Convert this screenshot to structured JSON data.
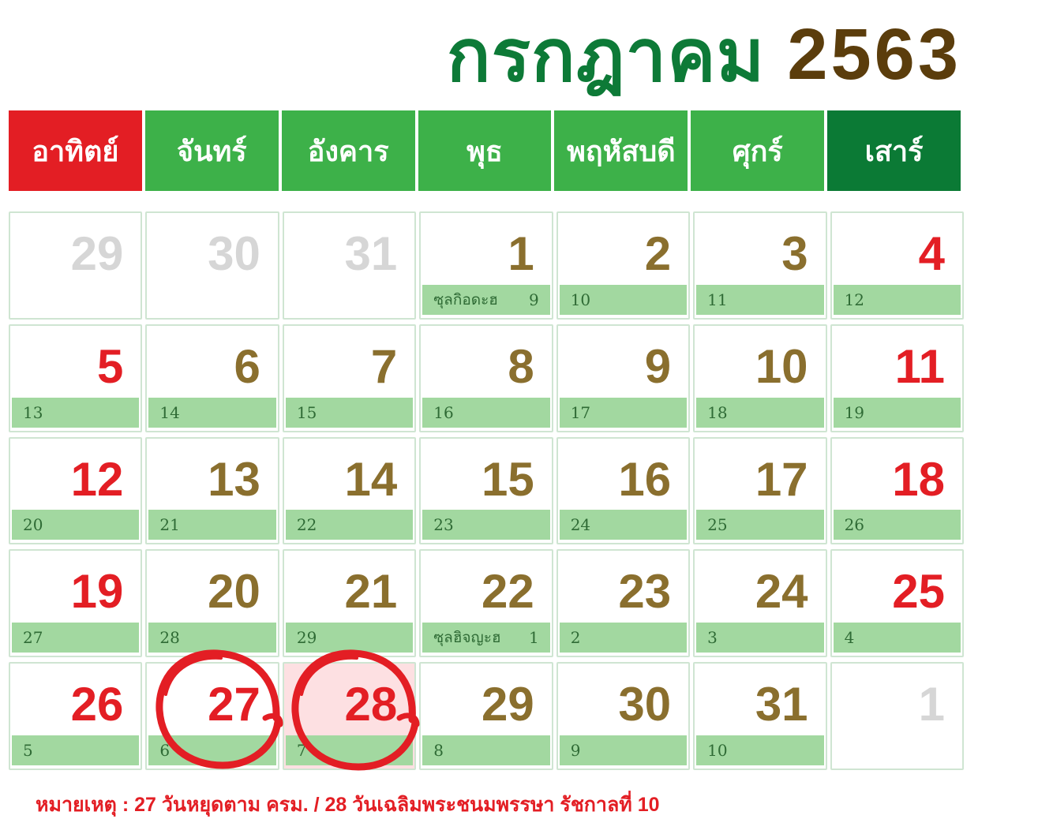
{
  "title": {
    "month": "กรกฎาคม",
    "year": "2563"
  },
  "weekdays": [
    "อาทิตย์",
    "จันทร์",
    "อังคาร",
    "พุธ",
    "พฤหัสบดี",
    "ศุกร์",
    "เสาร์"
  ],
  "colors": {
    "sunday": "#e31e24",
    "weekday": "#3db149",
    "saturday": "#0b7a35",
    "day_text": "#8a6f2e",
    "lunar_strip": "#a2d8a0"
  },
  "weeks": [
    [
      {
        "day": "29",
        "tone": "grey",
        "lunar": ""
      },
      {
        "day": "30",
        "tone": "grey",
        "lunar": ""
      },
      {
        "day": "31",
        "tone": "grey",
        "lunar": ""
      },
      {
        "day": "1",
        "tone": "normal",
        "lunar": "9",
        "lunar_name": "ซุลกิอดะฮ"
      },
      {
        "day": "2",
        "tone": "normal",
        "lunar": "10"
      },
      {
        "day": "3",
        "tone": "normal",
        "lunar": "11"
      },
      {
        "day": "4",
        "tone": "red",
        "lunar": "12"
      }
    ],
    [
      {
        "day": "5",
        "tone": "red",
        "lunar": "13"
      },
      {
        "day": "6",
        "tone": "normal",
        "lunar": "14"
      },
      {
        "day": "7",
        "tone": "normal",
        "lunar": "15"
      },
      {
        "day": "8",
        "tone": "normal",
        "lunar": "16"
      },
      {
        "day": "9",
        "tone": "normal",
        "lunar": "17"
      },
      {
        "day": "10",
        "tone": "normal",
        "lunar": "18"
      },
      {
        "day": "11",
        "tone": "red",
        "lunar": "19"
      }
    ],
    [
      {
        "day": "12",
        "tone": "red",
        "lunar": "20"
      },
      {
        "day": "13",
        "tone": "normal",
        "lunar": "21"
      },
      {
        "day": "14",
        "tone": "normal",
        "lunar": "22"
      },
      {
        "day": "15",
        "tone": "normal",
        "lunar": "23"
      },
      {
        "day": "16",
        "tone": "normal",
        "lunar": "24"
      },
      {
        "day": "17",
        "tone": "normal",
        "lunar": "25"
      },
      {
        "day": "18",
        "tone": "red",
        "lunar": "26"
      }
    ],
    [
      {
        "day": "19",
        "tone": "red",
        "lunar": "27"
      },
      {
        "day": "20",
        "tone": "normal",
        "lunar": "28"
      },
      {
        "day": "21",
        "tone": "normal",
        "lunar": "29"
      },
      {
        "day": "22",
        "tone": "normal",
        "lunar": "1",
        "lunar_name": "ซุลฮิจญะฮ"
      },
      {
        "day": "23",
        "tone": "normal",
        "lunar": "2"
      },
      {
        "day": "24",
        "tone": "normal",
        "lunar": "3"
      },
      {
        "day": "25",
        "tone": "red",
        "lunar": "4"
      }
    ],
    [
      {
        "day": "26",
        "tone": "red",
        "lunar": "5"
      },
      {
        "day": "27",
        "tone": "red",
        "lunar": "6",
        "circled": true
      },
      {
        "day": "28",
        "tone": "red",
        "lunar": "7",
        "circled": true,
        "highlight": true
      },
      {
        "day": "29",
        "tone": "normal",
        "lunar": "8"
      },
      {
        "day": "30",
        "tone": "normal",
        "lunar": "9"
      },
      {
        "day": "31",
        "tone": "normal",
        "lunar": "10"
      },
      {
        "day": "1",
        "tone": "grey",
        "lunar": ""
      }
    ]
  ],
  "note": "หมายเหตุ : 27 วันหยุดตาม ครม. / 28 วันเฉลิมพระชนมพรรษา รัชกาลที่ 10"
}
